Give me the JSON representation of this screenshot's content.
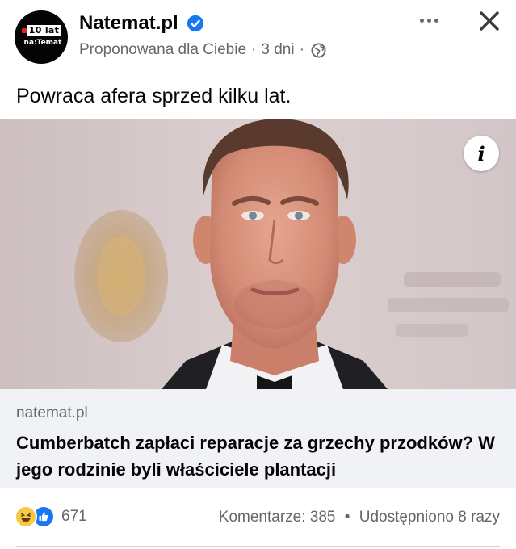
{
  "post": {
    "page_name": "Natemat.pl",
    "verified": true,
    "audience_label": "Proponowana dla Ciebie",
    "separator": "·",
    "time": "3 dni",
    "privacy_icon": "globe-icon",
    "avatar": {
      "badge_text": "10 lat",
      "brand_text": "na:Temat"
    },
    "text": "Powraca afera sprzed kilku lat."
  },
  "media": {
    "photo_icon": "portrait-photo",
    "info_label": "i"
  },
  "link_preview": {
    "domain": "natemat.pl",
    "title": "Cumberbatch zapłaci reparacje za grzechy przodków? W jego rodzinie byli właściciele plantacji"
  },
  "engagement": {
    "reactions": [
      "haha-icon",
      "like-icon"
    ],
    "reaction_count": "671",
    "comments_text": "Komentarze: 385",
    "separator": "•",
    "shares_text": "Udostępniono 8 razy"
  },
  "colors": {
    "verified_blue": "#1877f2",
    "secondary_text": "#65676b",
    "card_background": "#f0f2f5"
  }
}
